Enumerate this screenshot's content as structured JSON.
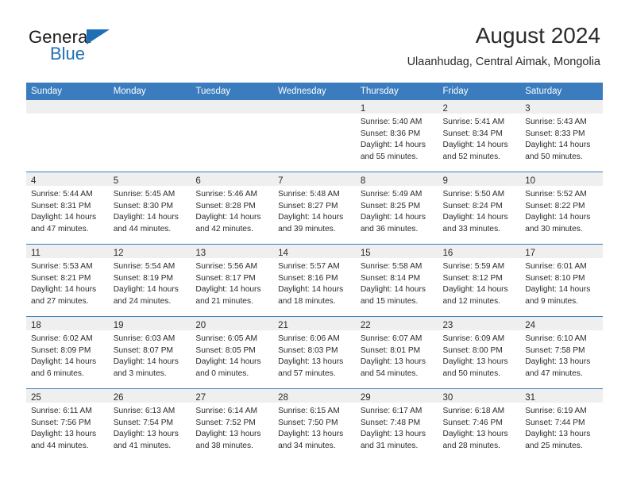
{
  "brand": {
    "name_part1": "General",
    "name_part2": "Blue",
    "accent_color": "#1f6fb5"
  },
  "header": {
    "title": "August 2024",
    "subtitle": "Ulaanhudag, Central Aimak, Mongolia"
  },
  "theme": {
    "header_bg": "#3a7cbe",
    "daynum_band": "#efefef",
    "text": "#2b2b2b"
  },
  "weekdays": [
    "Sunday",
    "Monday",
    "Tuesday",
    "Wednesday",
    "Thursday",
    "Friday",
    "Saturday"
  ],
  "weeks": [
    [
      {
        "day": "",
        "lines": []
      },
      {
        "day": "",
        "lines": []
      },
      {
        "day": "",
        "lines": []
      },
      {
        "day": "",
        "lines": []
      },
      {
        "day": "1",
        "lines": [
          "Sunrise: 5:40 AM",
          "Sunset: 8:36 PM",
          "Daylight: 14 hours",
          "and 55 minutes."
        ]
      },
      {
        "day": "2",
        "lines": [
          "Sunrise: 5:41 AM",
          "Sunset: 8:34 PM",
          "Daylight: 14 hours",
          "and 52 minutes."
        ]
      },
      {
        "day": "3",
        "lines": [
          "Sunrise: 5:43 AM",
          "Sunset: 8:33 PM",
          "Daylight: 14 hours",
          "and 50 minutes."
        ]
      }
    ],
    [
      {
        "day": "4",
        "lines": [
          "Sunrise: 5:44 AM",
          "Sunset: 8:31 PM",
          "Daylight: 14 hours",
          "and 47 minutes."
        ]
      },
      {
        "day": "5",
        "lines": [
          "Sunrise: 5:45 AM",
          "Sunset: 8:30 PM",
          "Daylight: 14 hours",
          "and 44 minutes."
        ]
      },
      {
        "day": "6",
        "lines": [
          "Sunrise: 5:46 AM",
          "Sunset: 8:28 PM",
          "Daylight: 14 hours",
          "and 42 minutes."
        ]
      },
      {
        "day": "7",
        "lines": [
          "Sunrise: 5:48 AM",
          "Sunset: 8:27 PM",
          "Daylight: 14 hours",
          "and 39 minutes."
        ]
      },
      {
        "day": "8",
        "lines": [
          "Sunrise: 5:49 AM",
          "Sunset: 8:25 PM",
          "Daylight: 14 hours",
          "and 36 minutes."
        ]
      },
      {
        "day": "9",
        "lines": [
          "Sunrise: 5:50 AM",
          "Sunset: 8:24 PM",
          "Daylight: 14 hours",
          "and 33 minutes."
        ]
      },
      {
        "day": "10",
        "lines": [
          "Sunrise: 5:52 AM",
          "Sunset: 8:22 PM",
          "Daylight: 14 hours",
          "and 30 minutes."
        ]
      }
    ],
    [
      {
        "day": "11",
        "lines": [
          "Sunrise: 5:53 AM",
          "Sunset: 8:21 PM",
          "Daylight: 14 hours",
          "and 27 minutes."
        ]
      },
      {
        "day": "12",
        "lines": [
          "Sunrise: 5:54 AM",
          "Sunset: 8:19 PM",
          "Daylight: 14 hours",
          "and 24 minutes."
        ]
      },
      {
        "day": "13",
        "lines": [
          "Sunrise: 5:56 AM",
          "Sunset: 8:17 PM",
          "Daylight: 14 hours",
          "and 21 minutes."
        ]
      },
      {
        "day": "14",
        "lines": [
          "Sunrise: 5:57 AM",
          "Sunset: 8:16 PM",
          "Daylight: 14 hours",
          "and 18 minutes."
        ]
      },
      {
        "day": "15",
        "lines": [
          "Sunrise: 5:58 AM",
          "Sunset: 8:14 PM",
          "Daylight: 14 hours",
          "and 15 minutes."
        ]
      },
      {
        "day": "16",
        "lines": [
          "Sunrise: 5:59 AM",
          "Sunset: 8:12 PM",
          "Daylight: 14 hours",
          "and 12 minutes."
        ]
      },
      {
        "day": "17",
        "lines": [
          "Sunrise: 6:01 AM",
          "Sunset: 8:10 PM",
          "Daylight: 14 hours",
          "and 9 minutes."
        ]
      }
    ],
    [
      {
        "day": "18",
        "lines": [
          "Sunrise: 6:02 AM",
          "Sunset: 8:09 PM",
          "Daylight: 14 hours",
          "and 6 minutes."
        ]
      },
      {
        "day": "19",
        "lines": [
          "Sunrise: 6:03 AM",
          "Sunset: 8:07 PM",
          "Daylight: 14 hours",
          "and 3 minutes."
        ]
      },
      {
        "day": "20",
        "lines": [
          "Sunrise: 6:05 AM",
          "Sunset: 8:05 PM",
          "Daylight: 14 hours",
          "and 0 minutes."
        ]
      },
      {
        "day": "21",
        "lines": [
          "Sunrise: 6:06 AM",
          "Sunset: 8:03 PM",
          "Daylight: 13 hours",
          "and 57 minutes."
        ]
      },
      {
        "day": "22",
        "lines": [
          "Sunrise: 6:07 AM",
          "Sunset: 8:01 PM",
          "Daylight: 13 hours",
          "and 54 minutes."
        ]
      },
      {
        "day": "23",
        "lines": [
          "Sunrise: 6:09 AM",
          "Sunset: 8:00 PM",
          "Daylight: 13 hours",
          "and 50 minutes."
        ]
      },
      {
        "day": "24",
        "lines": [
          "Sunrise: 6:10 AM",
          "Sunset: 7:58 PM",
          "Daylight: 13 hours",
          "and 47 minutes."
        ]
      }
    ],
    [
      {
        "day": "25",
        "lines": [
          "Sunrise: 6:11 AM",
          "Sunset: 7:56 PM",
          "Daylight: 13 hours",
          "and 44 minutes."
        ]
      },
      {
        "day": "26",
        "lines": [
          "Sunrise: 6:13 AM",
          "Sunset: 7:54 PM",
          "Daylight: 13 hours",
          "and 41 minutes."
        ]
      },
      {
        "day": "27",
        "lines": [
          "Sunrise: 6:14 AM",
          "Sunset: 7:52 PM",
          "Daylight: 13 hours",
          "and 38 minutes."
        ]
      },
      {
        "day": "28",
        "lines": [
          "Sunrise: 6:15 AM",
          "Sunset: 7:50 PM",
          "Daylight: 13 hours",
          "and 34 minutes."
        ]
      },
      {
        "day": "29",
        "lines": [
          "Sunrise: 6:17 AM",
          "Sunset: 7:48 PM",
          "Daylight: 13 hours",
          "and 31 minutes."
        ]
      },
      {
        "day": "30",
        "lines": [
          "Sunrise: 6:18 AM",
          "Sunset: 7:46 PM",
          "Daylight: 13 hours",
          "and 28 minutes."
        ]
      },
      {
        "day": "31",
        "lines": [
          "Sunrise: 6:19 AM",
          "Sunset: 7:44 PM",
          "Daylight: 13 hours",
          "and 25 minutes."
        ]
      }
    ]
  ]
}
